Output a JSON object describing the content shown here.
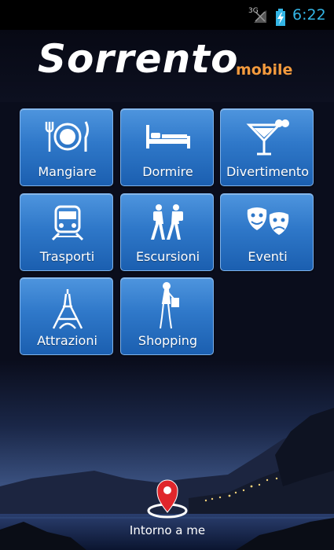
{
  "status_bar": {
    "network": "3G",
    "time": "6:22"
  },
  "header": {
    "title": "Sorrento",
    "subtitle": "mobile"
  },
  "menu": [
    {
      "label": "Mangiare",
      "icon": "plate-cutlery-icon"
    },
    {
      "label": "Dormire",
      "icon": "bed-icon"
    },
    {
      "label": "Divertimento",
      "icon": "cocktail-icon"
    },
    {
      "label": "Trasporti",
      "icon": "train-icon"
    },
    {
      "label": "Escursioni",
      "icon": "hikers-icon"
    },
    {
      "label": "Eventi",
      "icon": "theater-masks-icon"
    },
    {
      "label": "Attrazioni",
      "icon": "eiffel-tower-icon"
    },
    {
      "label": "Shopping",
      "icon": "shopper-icon"
    }
  ],
  "around_me": {
    "label": "Intorno a me",
    "icon": "location-pin-icon"
  },
  "colors": {
    "tile_top": "#4e95de",
    "tile_bottom": "#1b5fb0",
    "subtitle": "#f39a3d",
    "pin": "#e0262b",
    "clock": "#33b5e5"
  }
}
